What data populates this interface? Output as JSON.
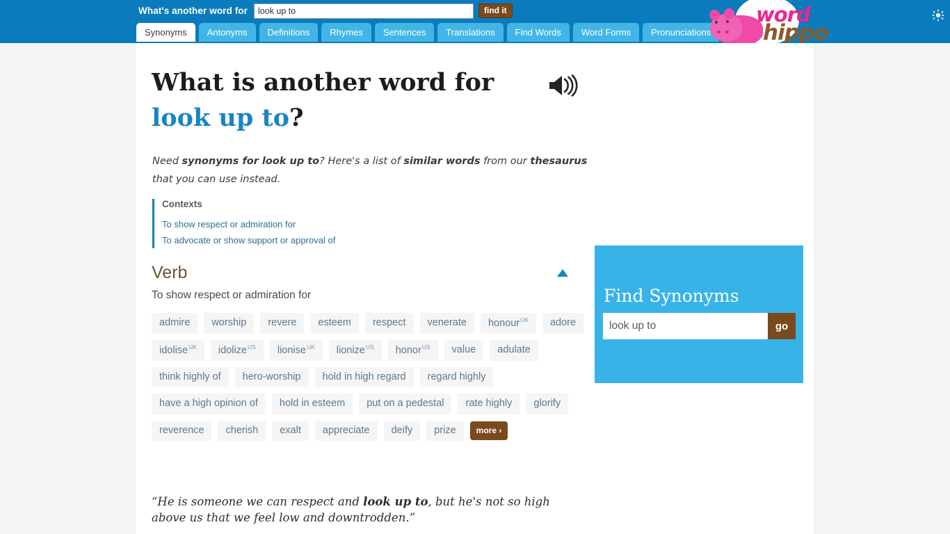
{
  "header": {
    "search_label": "What's another word for",
    "search_value": "look up to",
    "search_placeholder": "",
    "find_button": "find it",
    "logo_word": "word",
    "logo_hippo": "hippo",
    "sun_icon": "sun-icon",
    "bg_color": "#0a7cbd"
  },
  "tabs": [
    {
      "label": "Synonyms",
      "active": true
    },
    {
      "label": "Antonyms",
      "active": false
    },
    {
      "label": "Definitions",
      "active": false
    },
    {
      "label": "Rhymes",
      "active": false
    },
    {
      "label": "Sentences",
      "active": false
    },
    {
      "label": "Translations",
      "active": false
    },
    {
      "label": "Find Words",
      "active": false
    },
    {
      "label": "Word Forms",
      "active": false
    },
    {
      "label": "Pronunciations",
      "active": false
    }
  ],
  "main": {
    "headline_prefix": "What is another word for",
    "headline_term": "look up to",
    "headline_suffix": "?",
    "speaker_icon": "speaker-icon",
    "lead_part1": "Need ",
    "lead_bold1": "synonyms for look up to",
    "lead_part2": "? Here's a list of ",
    "lead_bold2": "similar words",
    "lead_part3": " from our ",
    "lead_bold3": "thesaurus",
    "lead_part4": " that you can use instead.",
    "contexts_title": "Contexts",
    "contexts": [
      "To show respect or admiration for",
      "To advocate or show support or approval of"
    ],
    "pos_name": "Verb",
    "pos_definition": "To show respect or admiration for",
    "collapse_icon": "triangle-up-icon",
    "synonyms": [
      {
        "word": "admire",
        "tag": ""
      },
      {
        "word": "worship",
        "tag": ""
      },
      {
        "word": "revere",
        "tag": ""
      },
      {
        "word": "esteem",
        "tag": ""
      },
      {
        "word": "respect",
        "tag": ""
      },
      {
        "word": "venerate",
        "tag": ""
      },
      {
        "word": "honour",
        "tag": "UK"
      },
      {
        "word": "adore",
        "tag": ""
      },
      {
        "word": "idolise",
        "tag": "UK"
      },
      {
        "word": "idolize",
        "tag": "US"
      },
      {
        "word": "lionise",
        "tag": "UK"
      },
      {
        "word": "lionize",
        "tag": "US"
      },
      {
        "word": "honor",
        "tag": "US"
      },
      {
        "word": "value",
        "tag": ""
      },
      {
        "word": "adulate",
        "tag": ""
      },
      {
        "word": "think highly of",
        "tag": ""
      },
      {
        "word": "hero-worship",
        "tag": ""
      },
      {
        "word": "hold in high regard",
        "tag": ""
      },
      {
        "word": "regard highly",
        "tag": ""
      },
      {
        "word": "have a high opinion of",
        "tag": ""
      },
      {
        "word": "hold in esteem",
        "tag": ""
      },
      {
        "word": "put on a pedestal",
        "tag": ""
      },
      {
        "word": "rate highly",
        "tag": ""
      },
      {
        "word": "glorify",
        "tag": ""
      },
      {
        "word": "reverence",
        "tag": ""
      },
      {
        "word": "cherish",
        "tag": ""
      },
      {
        "word": "exalt",
        "tag": ""
      },
      {
        "word": "appreciate",
        "tag": ""
      },
      {
        "word": "deify",
        "tag": ""
      },
      {
        "word": "prize",
        "tag": ""
      }
    ],
    "more_label": "more ›",
    "quote_part1": "“He is someone we can respect and ",
    "quote_bold": "look up to",
    "quote_part2": ", but he's not so high above us that we feel low and downtrodden.”"
  },
  "sidebar": {
    "find_title": "Find Synonyms",
    "find_value": "look up to",
    "find_placeholder": "",
    "go_label": "go",
    "bg_color": "#37b3e8"
  }
}
